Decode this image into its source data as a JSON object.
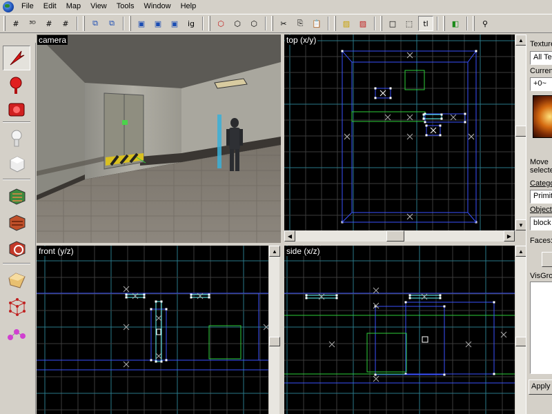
{
  "menu": {
    "items": [
      "File",
      "Edit",
      "Map",
      "View",
      "Tools",
      "Window",
      "Help"
    ]
  },
  "toolbar": {
    "buttons": [
      {
        "name": "grid-toggle-icon",
        "glyph": "#"
      },
      {
        "name": "3d-grid-icon",
        "glyph": "³ᴰ"
      },
      {
        "name": "smaller-grid-icon",
        "glyph": "#"
      },
      {
        "name": "larger-grid-icon",
        "glyph": "#"
      },
      {
        "name": "group-icon",
        "glyph": "⧉"
      },
      {
        "name": "ungroup-icon",
        "glyph": "⧉"
      },
      {
        "name": "texture-lock-icon",
        "glyph": "▣"
      },
      {
        "name": "hide-icon",
        "glyph": "▣"
      },
      {
        "name": "unhide-icon",
        "glyph": "▣"
      },
      {
        "name": "ignore-groups-label",
        "glyph": "ig"
      },
      {
        "name": "carve-icon",
        "glyph": "⬡"
      },
      {
        "name": "hollow-icon",
        "glyph": "⬡"
      },
      {
        "name": "clip-icon",
        "glyph": "⬡"
      },
      {
        "name": "cut-icon",
        "glyph": "✂"
      },
      {
        "name": "copy-icon",
        "glyph": "⎘"
      },
      {
        "name": "paste-icon",
        "glyph": "📋"
      },
      {
        "name": "hazard-icon",
        "glyph": "▨"
      },
      {
        "name": "hazard-red-icon",
        "glyph": "▨"
      },
      {
        "name": "select-box-icon",
        "glyph": "□"
      },
      {
        "name": "select-dots-icon",
        "glyph": "⬚"
      },
      {
        "name": "toggle-tl-label",
        "glyph": "tl"
      },
      {
        "name": "run-map-icon",
        "glyph": "◧"
      },
      {
        "name": "misc-icon",
        "glyph": "⚲"
      }
    ]
  },
  "tools": [
    {
      "name": "selection-tool-icon",
      "pressed": true
    },
    {
      "name": "magnify-tool-icon",
      "pressed": false
    },
    {
      "name": "camera-tool-icon",
      "pressed": false
    },
    {
      "name": "entity-tool-icon",
      "pressed": false
    },
    {
      "name": "block-tool-icon",
      "pressed": false
    },
    {
      "name": "texture-app-icon",
      "pressed": false
    },
    {
      "name": "apply-texture-icon",
      "pressed": false
    },
    {
      "name": "decal-tool-icon",
      "pressed": false
    },
    {
      "name": "clip-tool-icon",
      "pressed": false
    },
    {
      "name": "vertex-tool-icon",
      "pressed": false
    },
    {
      "name": "path-tool-icon",
      "pressed": false
    }
  ],
  "viewports": {
    "camera": "camera",
    "top": "top (x/y)",
    "front": "front (y/z)",
    "side": "side (x/z)"
  },
  "right_panel": {
    "textures_label": "Textures",
    "textures_filter": "All Te",
    "current_label": "Current",
    "current_texture": "+0~",
    "move_selected_line1": "Move",
    "move_selected_line2": "selecte",
    "categories_label": "Catego",
    "category_value": "Primitiv",
    "objects_label": "Objects",
    "object_value": "block",
    "faces_label": "Faces:",
    "visgroups_label": "VisGrou",
    "apply_button": "Apply"
  },
  "colors": {
    "chrome": "#d4d0c8",
    "grid_major": "#2a7a8a",
    "grid_minor": "#3c3c3c",
    "brush_blue": "#3a52ff",
    "selection_green": "#2ecf3a",
    "selected_white": "#ffffff"
  }
}
